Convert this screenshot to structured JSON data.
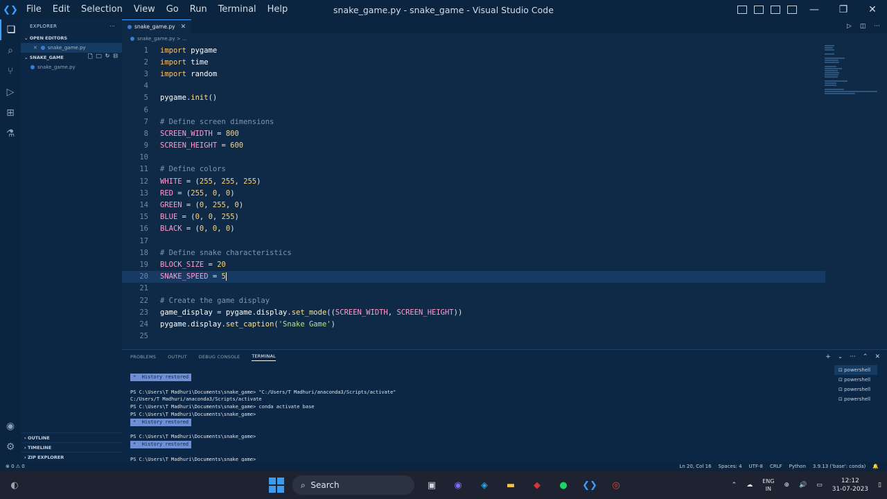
{
  "titlebar": {
    "menu": [
      "File",
      "Edit",
      "Selection",
      "View",
      "Go",
      "Run",
      "Terminal",
      "Help"
    ],
    "title": "snake_game.py - snake_game - Visual Studio Code"
  },
  "sidebar": {
    "header": "EXPLORER",
    "open_editors": "OPEN EDITORS",
    "open_file": "snake_game.py",
    "folder": "SNAKE_GAME",
    "file": "snake_game.py",
    "outline": "OUTLINE",
    "timeline": "TIMELINE",
    "zip_explorer": "ZIP EXPLORER"
  },
  "editor": {
    "tab": "snake_game.py",
    "breadcrumb": "snake_game.py > ...",
    "current_line": 20
  },
  "code": [
    {
      "n": "1",
      "t": "import pygame"
    },
    {
      "n": "2",
      "t": "import time"
    },
    {
      "n": "3",
      "t": "import random"
    },
    {
      "n": "4",
      "t": ""
    },
    {
      "n": "5",
      "t": "pygame.init()"
    },
    {
      "n": "6",
      "t": ""
    },
    {
      "n": "7",
      "t": "# Define screen dimensions"
    },
    {
      "n": "8",
      "t": "SCREEN_WIDTH = 800"
    },
    {
      "n": "9",
      "t": "SCREEN_HEIGHT = 600"
    },
    {
      "n": "10",
      "t": ""
    },
    {
      "n": "11",
      "t": "# Define colors"
    },
    {
      "n": "12",
      "t": "WHITE = (255, 255, 255)"
    },
    {
      "n": "13",
      "t": "RED = (255, 0, 0)"
    },
    {
      "n": "14",
      "t": "GREEN = (0, 255, 0)"
    },
    {
      "n": "15",
      "t": "BLUE = (0, 0, 255)"
    },
    {
      "n": "16",
      "t": "BLACK = (0, 0, 0)"
    },
    {
      "n": "17",
      "t": ""
    },
    {
      "n": "18",
      "t": "# Define snake characteristics"
    },
    {
      "n": "19",
      "t": "BLOCK_SIZE = 20"
    },
    {
      "n": "20",
      "t": "SNAKE_SPEED = 5"
    },
    {
      "n": "21",
      "t": ""
    },
    {
      "n": "22",
      "t": "# Create the game display"
    },
    {
      "n": "23",
      "t": "game_display = pygame.display.set_mode((SCREEN_WIDTH, SCREEN_HEIGHT))"
    },
    {
      "n": "24",
      "t": "pygame.display.set_caption('Snake Game')"
    },
    {
      "n": "25",
      "t": ""
    }
  ],
  "panel": {
    "tabs": [
      "PROBLEMS",
      "OUTPUT",
      "DEBUG CONSOLE",
      "TERMINAL"
    ],
    "active_tab": "TERMINAL",
    "history": "History restored",
    "terminal_lines": [
      "PS C:\\Users\\T Madhuri\\Documents\\snake_game> \"C:/Users/T Madhuri/anaconda3/Scripts/activate\"",
      "C:/Users/T Madhuri/anaconda3/Scripts/activate",
      "PS C:\\Users\\T Madhuri\\Documents\\snake_game> conda activate base",
      "PS C:\\Users\\T Madhuri\\Documents\\snake_game>"
    ],
    "prompt": "PS C:\\Users\\T Madhuri\\Documents\\snake_game>",
    "shells": [
      "powershell",
      "powershell",
      "powershell",
      "powershell"
    ]
  },
  "status": {
    "problems": "⊗ 0 ⚠ 0",
    "position": "Ln 20, Col 16",
    "spaces": "Spaces: 4",
    "encoding": "UTF-8",
    "eol": "CRLF",
    "language": "Python",
    "interpreter": "3.9.13 ('base': conda)"
  },
  "taskbar": {
    "search": "Search",
    "lang_top": "ENG",
    "lang_bottom": "IN",
    "time": "12:12",
    "date": "31-07-2023"
  }
}
